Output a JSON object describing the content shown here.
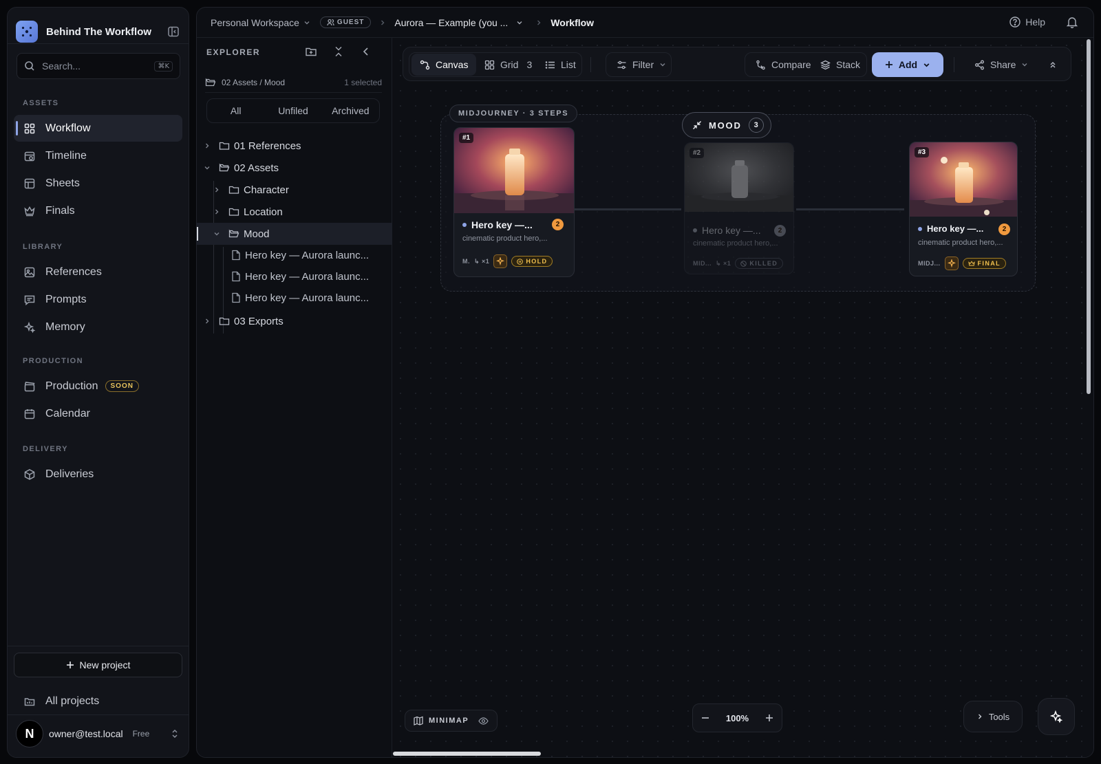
{
  "app": {
    "name": "Behind The Workflow"
  },
  "search": {
    "placeholder": "Search...",
    "shortcut": "⌘K"
  },
  "sidebar": {
    "sections": {
      "assets": "ASSETS",
      "library": "LIBRARY",
      "production": "PRODUCTION",
      "delivery": "DELIVERY"
    },
    "items": [
      {
        "label": "Workflow",
        "icon": "grid-icon",
        "active": true
      },
      {
        "label": "Timeline",
        "icon": "clock-calendar-icon"
      },
      {
        "label": "Sheets",
        "icon": "table-icon"
      },
      {
        "label": "Finals",
        "icon": "crown-icon"
      },
      {
        "label": "References",
        "icon": "image-icon"
      },
      {
        "label": "Prompts",
        "icon": "message-icon"
      },
      {
        "label": "Memory",
        "icon": "sparkles-icon"
      },
      {
        "label": "Production",
        "icon": "clapperboard-icon",
        "badge": "SOON"
      },
      {
        "label": "Calendar",
        "icon": "calendar-icon"
      },
      {
        "label": "Deliveries",
        "icon": "package-icon"
      }
    ],
    "new_project": "New project",
    "all_projects": "All projects",
    "user": {
      "initial": "N",
      "email": "owner@test.local",
      "plan": "Free"
    }
  },
  "breadcrumb": {
    "workspace": "Personal Workspace",
    "role": "GUEST",
    "project": "Aurora — Example (you ...",
    "page": "Workflow"
  },
  "header": {
    "help": "Help"
  },
  "explorer": {
    "title": "EXPLORER",
    "path": "02 Assets / Mood",
    "selection": "1 selected",
    "filters": [
      "All",
      "Unfiled",
      "Archived"
    ],
    "tree": [
      {
        "label": "01 References"
      },
      {
        "label": "02 Assets"
      },
      {
        "label": "Character"
      },
      {
        "label": "Location"
      },
      {
        "label": "Mood"
      },
      {
        "label": "Hero key — Aurora launc..."
      },
      {
        "label": "Hero key — Aurora launc..."
      },
      {
        "label": "Hero key — Aurora launc..."
      },
      {
        "label": "03 Exports"
      }
    ]
  },
  "toolbar": {
    "canvas": "Canvas",
    "grid": "Grid",
    "grid_count": "3",
    "list": "List",
    "filter": "Filter",
    "compare": "Compare",
    "stack": "Stack",
    "add": "Add",
    "share": "Share"
  },
  "canvas": {
    "group_label": "MIDJOURNEY · 3 STEPS",
    "stack_label": "MOOD",
    "stack_count": "3",
    "cards": [
      {
        "num": "#1",
        "title": "Hero key —...",
        "count": "2",
        "desc": "cinematic product hero,...",
        "model": "M.",
        "branches": "↳ ×1",
        "status": "HOLD"
      },
      {
        "num": "#2",
        "title": "Hero key —...",
        "count": "2",
        "desc": "cinematic product hero,...",
        "model": "MID...",
        "branches": "↳ ×1",
        "status": "KILLED"
      },
      {
        "num": "#3",
        "title": "Hero key —...",
        "count": "2",
        "desc": "cinematic product hero,...",
        "model": "MIDJ...",
        "status": "FINAL"
      }
    ],
    "minimap": "MINIMAP",
    "zoom": "100%",
    "tools": "Tools"
  },
  "colors": {
    "accent": "#9bb1ee",
    "warning": "#f1c04e",
    "count_badge": "#f0993e",
    "bg": "#07080b"
  }
}
